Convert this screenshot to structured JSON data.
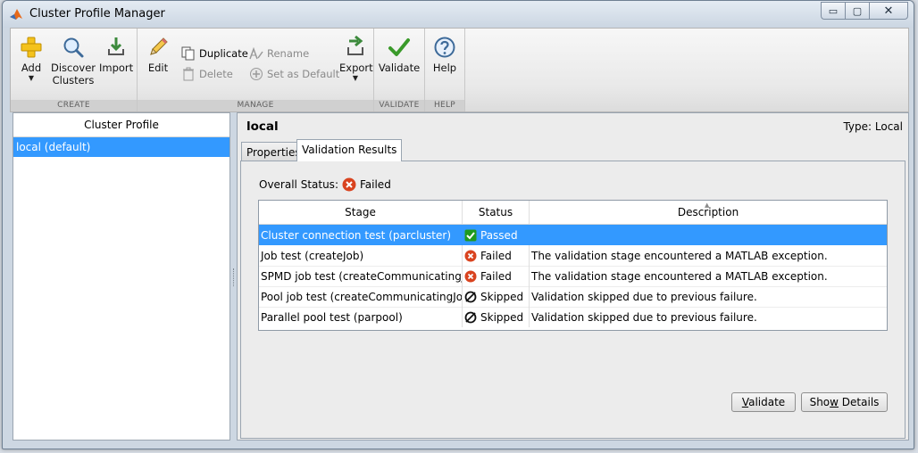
{
  "window": {
    "title": "Cluster Profile Manager",
    "minimize": "▭",
    "maximize": "▢",
    "close": "✕"
  },
  "toolstrip": {
    "groups": {
      "create": "CREATE",
      "manage": "MANAGE",
      "validate": "VALIDATE",
      "help": "HELP"
    },
    "add": "Add",
    "discover_line1": "Discover",
    "discover_line2": "Clusters",
    "import": "Import",
    "edit": "Edit",
    "duplicate": "Duplicate",
    "delete": "Delete",
    "rename": "Rename",
    "set_default": "Set as Default",
    "export": "Export",
    "validate": "Validate",
    "help": "Help",
    "caret": "▼"
  },
  "profiles": {
    "header": "Cluster Profile",
    "items": [
      {
        "label": "local (default)",
        "selected": true
      }
    ]
  },
  "detail": {
    "name": "local",
    "type": "Type: Local",
    "tabs": [
      {
        "label": "Properties"
      },
      {
        "label": "Validation Results"
      }
    ],
    "overall_label": "Overall Status:",
    "overall_value": "Failed",
    "columns": {
      "stage": "Stage",
      "status": "Status",
      "description": "Description"
    },
    "sort_indicator": "▲",
    "rows": [
      {
        "stage": "Cluster connection test (parcluster)",
        "status": "Passed",
        "icon": "check-icon",
        "description": ""
      },
      {
        "stage": "Job test (createJob)",
        "status": "Failed",
        "icon": "error-icon",
        "description": "The validation stage encountered a MATLAB exception."
      },
      {
        "stage": "SPMD job test (createCommunicatingJob)",
        "status": "Failed",
        "icon": "error-icon",
        "description": "The validation stage encountered a MATLAB exception."
      },
      {
        "stage": "Pool job test (createCommunicatingJob)",
        "status": "Skipped",
        "icon": "skip-icon",
        "description": "Validation skipped due to previous failure."
      },
      {
        "stage": "Parallel pool test (parpool)",
        "status": "Skipped",
        "icon": "skip-icon",
        "description": "Validation skipped due to previous failure."
      }
    ],
    "validate_button": {
      "mnemonic": "V",
      "rest": "alidate"
    },
    "show_details_button": {
      "pre": "Sho",
      "mnemonic": "w",
      "rest": " Details"
    }
  },
  "colors": {
    "selection": "#3399ff",
    "passed": "#1f9a1f",
    "failed": "#d9431f"
  }
}
